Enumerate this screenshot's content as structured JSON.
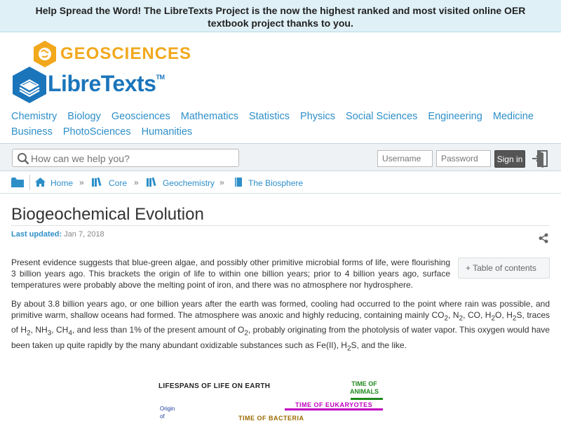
{
  "banner": {
    "text": "Help Spread the Word! The LibreTexts Project is the now the highest ranked and most visited online OER textbook project thanks to you."
  },
  "logo": {
    "library": "GEOSCIENCES",
    "brand": "LibreTexts",
    "tm": "TM",
    "library_color": "#f2a81d",
    "brand_color": "#1b75bb"
  },
  "subjects": [
    "Chemistry",
    "Biology",
    "Geosciences",
    "Mathematics",
    "Statistics",
    "Physics",
    "Social Sciences",
    "Engineering",
    "Medicine",
    "Business",
    "PhotoSciences",
    "Humanities"
  ],
  "toolbar": {
    "search_placeholder": "How can we help you?",
    "username_placeholder": "Username",
    "password_placeholder": "Password",
    "signin_label": "Sign in"
  },
  "breadcrumb": {
    "items": [
      "Home",
      "Core",
      "Geochemistry",
      "The Biosphere"
    ],
    "separator": "»"
  },
  "page": {
    "title": "Biogeochemical Evolution",
    "last_updated_label": "Last updated:",
    "last_updated_date": "Jan 7, 2018",
    "toc_label": "+ Table of contents",
    "p1": "Present evidence suggests that blue-green algae, and possibly other primitive microbial forms of life, were flourishing 3 billion years ago. This brackets the origin of life to within one billion years; prior to 4 billion years ago, surface temperatures were probably above the melting point of iron, and there was no atmosphere nor hydrosphere.",
    "p2": {
      "a": "By about 3.8 billion years ago, or one billion years after the earth was formed, cooling had occurred to the point where rain was possible, and primitive warm, shallow oceans had formed. The atmosphere was anoxic and highly reducing, containing mainly CO",
      "b": ", N",
      "c": ", CO, H",
      "d": "O, H",
      "e": "S, traces of H",
      "f": ", NH",
      "g": ", CH",
      "h": ", and less than 1% of the present amount of O",
      "i": ", probably originating from the photolysis of water vapor. This oxygen would have been taken up quite rapidly by the many abundant oxidizable substances such as Fe(II), H",
      "j": "S, and the like.",
      "sub2": "2",
      "sub3": "3",
      "sub4": "4"
    }
  },
  "figure": {
    "title": "LIFESPANS OF LIFE ON EARTH",
    "animals": "TIME OF ANIMALS",
    "animals_line1": "TIME OF",
    "animals_line2": "ANIMALS",
    "eukaryotes": "TIME OF EUKARYOTES",
    "origin_line1": "Origin",
    "origin_line2": "of",
    "bacteria": "TIME OF BACTERIA",
    "colors": {
      "animals": "#1f8a1f",
      "eukaryotes": "#c000c0",
      "bacteria": "#9a6a00",
      "origin": "#1b3d9c"
    }
  }
}
